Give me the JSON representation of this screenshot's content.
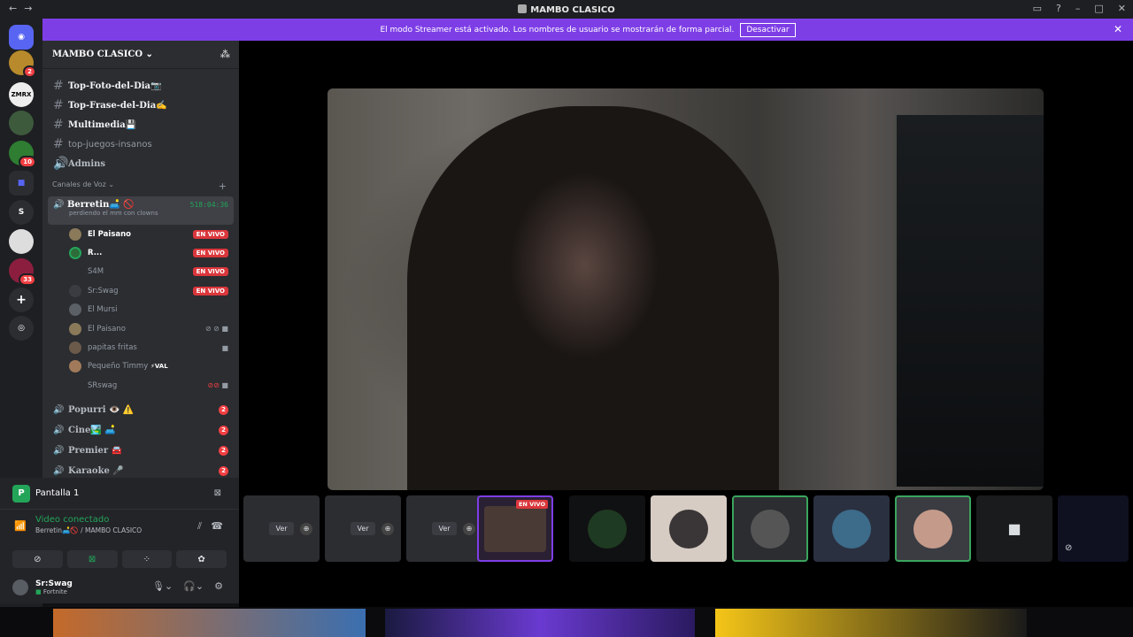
{
  "window": {
    "title": "MAMBO CLASICO"
  },
  "banner": {
    "text": "El modo Streamer está activado. Los nombres de usuario se mostrarán de forma parcial.",
    "button": "Desactivar"
  },
  "rail": {
    "badges": [
      "2",
      "10",
      "33"
    ],
    "letter_server": "S"
  },
  "guild": {
    "name": "MAMBO CLASICO"
  },
  "text_channels": [
    "Top-Foto-del-Dia📷",
    "Top-Frase-del-Dia✍️",
    "Multimedia💾",
    "top-juegos-insanos",
    "Admins"
  ],
  "voice_category": "Canales de Voz",
  "active_voice": {
    "name": "Berretin🛋️ 🚫",
    "time": "518:04:36",
    "status": "perdiendo el mm con clowns"
  },
  "users": [
    {
      "name": "El Paisano",
      "live": "EN VIVO"
    },
    {
      "name": "R...",
      "live": "EN VIVO"
    },
    {
      "name": "S4M",
      "live": "EN VIVO"
    },
    {
      "name": "Sr:Swag",
      "live": "EN VIVO"
    },
    {
      "name": "El Mursi"
    },
    {
      "name": "El Paisano"
    },
    {
      "name": "papitas fritas"
    },
    {
      "name": "Pequeño Timmy",
      "tag": "⚡VAL"
    },
    {
      "name": "SRswag"
    }
  ],
  "voice_channels": [
    {
      "name": "Popurri 👁️ ⚠️",
      "count": "2"
    },
    {
      "name": "Cine🏞️ 🛋️",
      "count": "2"
    },
    {
      "name": "Premier 🚘",
      "count": "2"
    },
    {
      "name": "Karaoke 🎤",
      "count": "2"
    }
  ],
  "panel": {
    "stream_title": "Pantalla 1",
    "stream_initial": "P",
    "video_status": "Video conectado",
    "video_sub": "Berretin🛋️🚫 / MAMBO CLASICO"
  },
  "me": {
    "name": "Sr:Swag",
    "activity": "Fortnite"
  },
  "thumbs": {
    "view_label": "Ver",
    "live_label": "EN VIVO"
  }
}
